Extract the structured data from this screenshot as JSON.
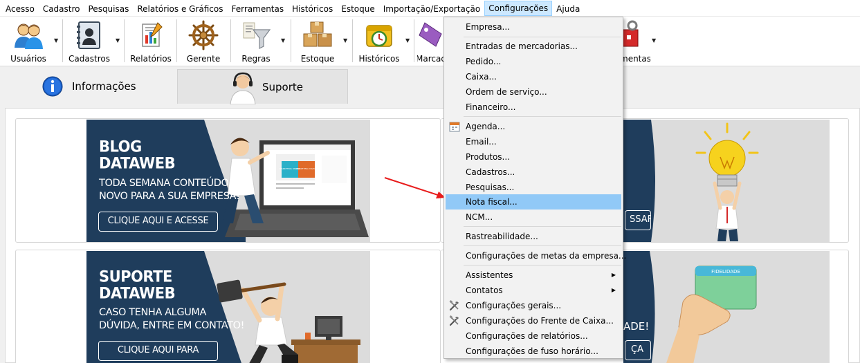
{
  "menubar": {
    "items": [
      "Acesso",
      "Cadastro",
      "Pesquisas",
      "Relatórios e Gráficos",
      "Ferramentas",
      "Históricos",
      "Estoque",
      "Importação/Exportação",
      "Configurações",
      "Ajuda"
    ]
  },
  "toolbar": {
    "usuarios": "Usuários",
    "cadastros": "Cadastros",
    "relatorios": "Relatórios",
    "gerente": "Gerente",
    "regras": "Regras",
    "estoque": "Estoque",
    "historicos": "Históricos",
    "marcadores": "Marcad",
    "ferramentas": "mentas"
  },
  "tabs": {
    "informacoes": "Informações",
    "suporte": "Suporte"
  },
  "banners": {
    "blog": {
      "title1": "BLOG",
      "title2": "DATAWEB",
      "sub1": "TODA SEMANA CONTEÚDO",
      "sub2": "NOVO PARA A SUA EMPRESA!",
      "button": "CLIQUE AQUI E ACESSE"
    },
    "suporte": {
      "title1": "SUPORTE",
      "title2": "DATAWEB",
      "sub1": "CASO TENHA ALGUMA",
      "sub2": "DÚVIDA, ENTRE EM CONTATO!",
      "button": "CLIQUE AQUI PARA ACESSAR"
    },
    "right_top_button": "SSAR",
    "right_bottom_text": "ADE!",
    "right_bottom_button": "ÇA",
    "card_label": "FIDELIDADE",
    "laptop_tags": [
      "MARKETING ONLINE",
      "MARKETING DIGITAL"
    ]
  },
  "dropdown": {
    "items": [
      "Empresa...",
      "Entradas de mercadorias...",
      "Pedido...",
      "Caixa...",
      "Ordem de serviço...",
      "Financeiro...",
      "Agenda...",
      "Email...",
      "Produtos...",
      "Cadastros...",
      "Pesquisas...",
      "Nota fiscal...",
      "NCM...",
      "Rastreabilidade...",
      "Configurações de metas da empresa...",
      "Assistentes",
      "Contatos",
      "Configurações gerais...",
      "Configurações do Frente de Caixa...",
      "Configurações de relatórios...",
      "Configurações de fuso horário..."
    ]
  },
  "colors": {
    "highlight": "#91c9f7",
    "banner_navy": "#1f3d5c",
    "arrow_red": "#e81c1c"
  }
}
